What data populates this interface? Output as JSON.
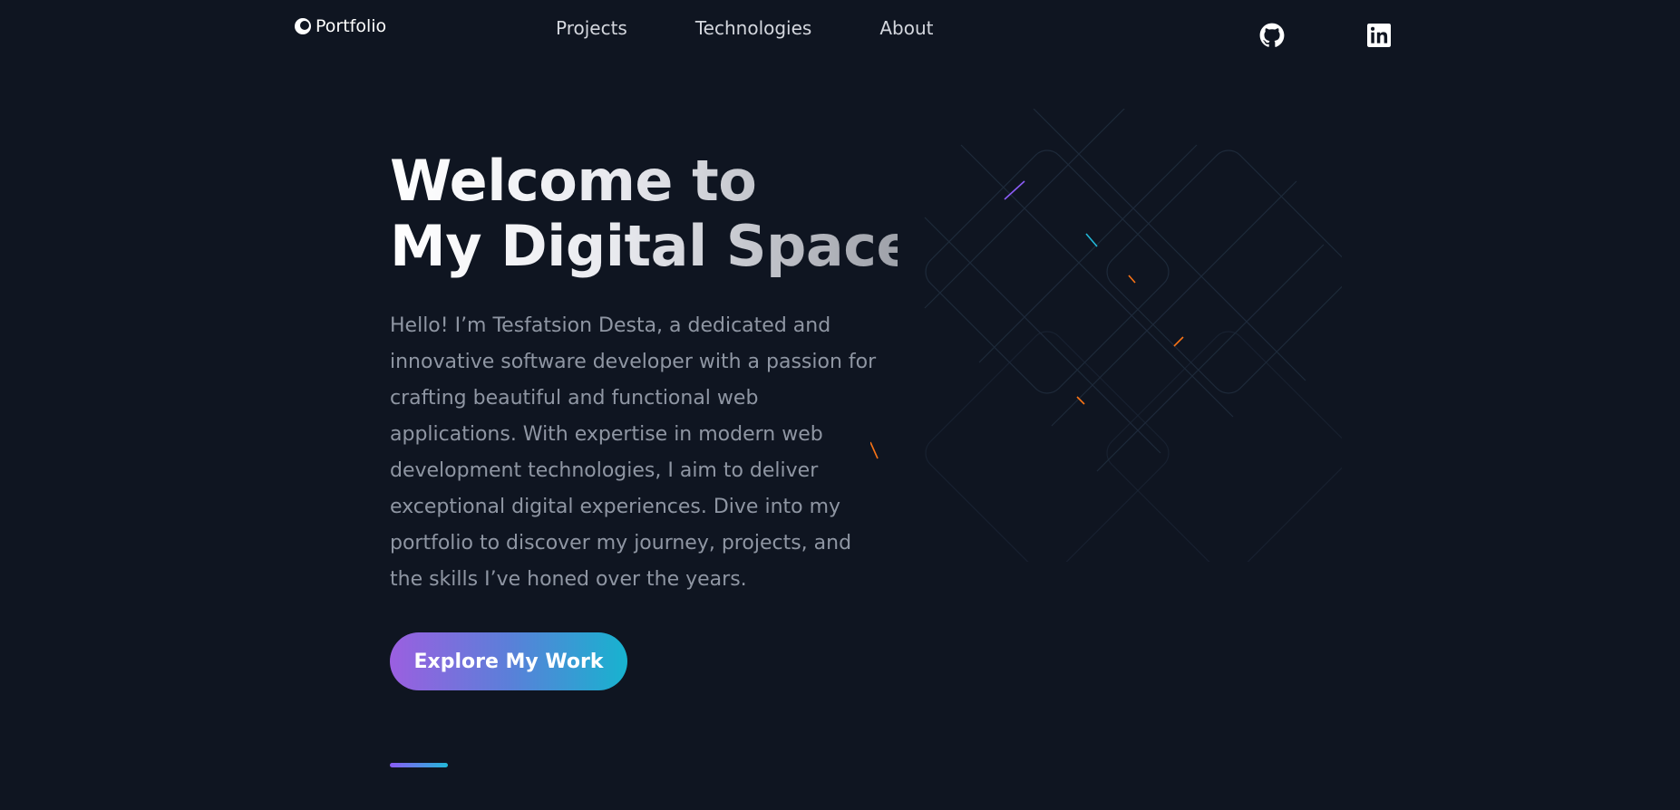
{
  "nav": {
    "logo_text": "Portfolio",
    "links": [
      {
        "label": "Projects"
      },
      {
        "label": "Technologies"
      },
      {
        "label": "About"
      }
    ],
    "social": [
      {
        "icon": "github-icon"
      },
      {
        "icon": "linkedin-icon"
      }
    ]
  },
  "hero": {
    "title_line1": "Welcome to",
    "title_line2": "My Digital Space",
    "description": "Hello! I’m Tesfatsion Desta, a dedicated and innovative software developer with a passion for crafting beautiful and functional web applications. With expertise in modern web development technologies, I aim to deliver exceptional digital experiences. Dive into my portfolio to discover my journey, projects, and the skills I’ve honed over the years.",
    "cta_label": "Explore My Work"
  },
  "colors": {
    "background": "#0f1521",
    "accent_purple": "#9b5fe0",
    "accent_cyan": "#17b3cf",
    "text_muted": "#8f96a3"
  }
}
